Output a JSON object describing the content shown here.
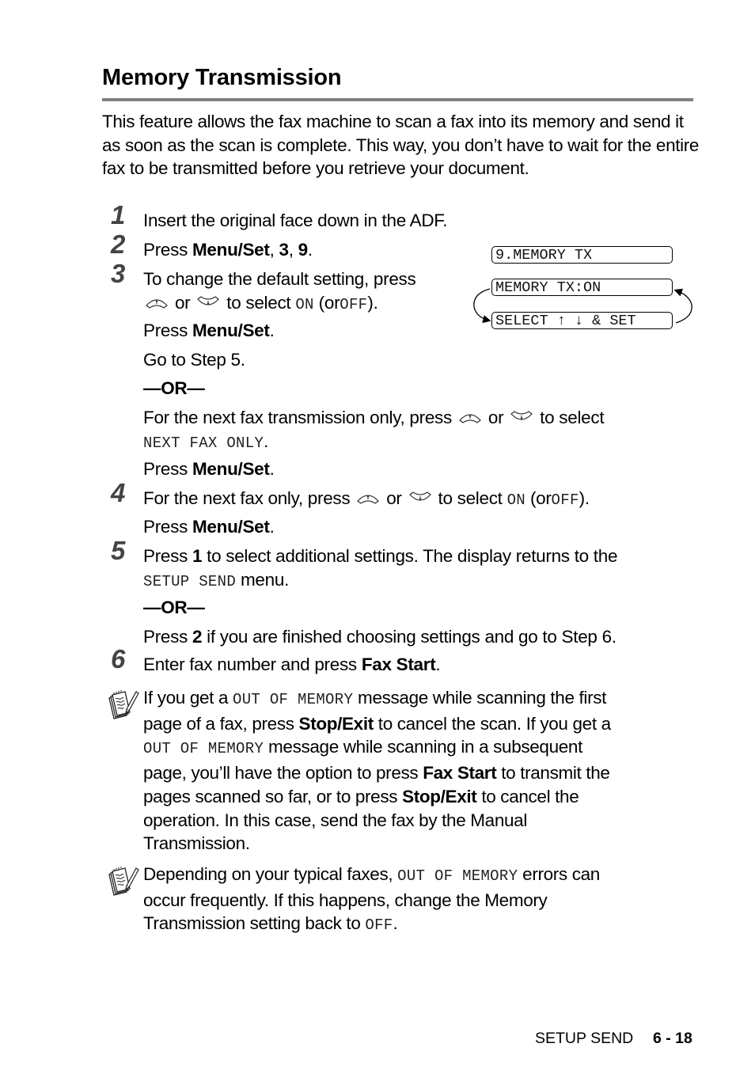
{
  "page_title": "Memory Transmission",
  "intro": "This feature allows the fax machine to scan a fax into its memory and send it as soon as the scan is complete. This way, you don’t have to wait for the entire fax to be transmitted before you retrieve your document.",
  "steps": {
    "s1": {
      "num": "1",
      "text": "Insert the original face down in the ADF."
    },
    "s2": {
      "num": "2",
      "pre": "Press ",
      "b1": "Menu/Set",
      "sep1": ", ",
      "b2": "3",
      "sep2": ", ",
      "b3": "9",
      "post": "."
    },
    "s3": {
      "num": "3",
      "line1": "To change the default setting, press",
      "or": "or",
      "to_select": "to select",
      "on": "ON",
      "paren_or": "(or",
      "off": "OFF",
      "close": ").",
      "press": "Press ",
      "menuset": "Menu/Set",
      "dot": ".",
      "goto": "Go to Step 5.",
      "or_sep": "—OR—",
      "alt_line1_pre": "For the next fax transmission only, press",
      "alt_line1_post": "to select",
      "alt_value": "NEXT FAX ONLY",
      "alt_value_dot": "."
    },
    "s4": {
      "num": "4",
      "pre": "For the next fax only, press",
      "or": "or",
      "to_select": "to select",
      "on": "ON",
      "paren_or": "(or",
      "off": "OFF",
      "close": ")."
    },
    "s5": {
      "num": "5",
      "pre": "Press ",
      "b1": "1",
      "post": " to select additional settings. The display returns to the",
      "menu_value": "SETUP SEND",
      "menu_post": " menu.",
      "or_sep": "—OR—",
      "alt_pre": "Press ",
      "alt_b": "2",
      "alt_post": " if you are finished choosing settings and go to Step 6."
    },
    "s6": {
      "num": "6",
      "pre": "Enter fax number and press ",
      "b1": "Fax Start",
      "post": "."
    }
  },
  "lcd": {
    "line1": "9.MEMORY TX",
    "line2": "MEMORY TX:ON",
    "line3": "SELECT ↑ ↓ & SET"
  },
  "notes": {
    "n1": {
      "a": "If you get a ",
      "m1": "OUT OF MEMORY",
      "b": " message while scanning the first",
      "c": "page of a fax, press ",
      "k1": "Stop/Exit",
      "d": " to cancel the scan. If you get a",
      "m2": "OUT OF MEMORY",
      "e": " message while scanning in a subsequent",
      "f": "page, you’ll have the option to press ",
      "k2": "Fax Start",
      "g": " to transmit the",
      "h": "pages scanned so far, or to press ",
      "k3": "Stop/Exit",
      "i": " to cancel the",
      "j": "operation. In this case, send the fax by the Manual",
      "k": "Transmission."
    },
    "n2": {
      "a": "Depending on your typical faxes, ",
      "m1": "OUT OF MEMORY",
      "b": " errors can",
      "c": "occur frequently. If this happens, change the Memory",
      "d": "Transmission setting back to ",
      "m2": "OFF",
      "e": "."
    }
  },
  "footer": {
    "section": "SETUP SEND",
    "page": "6 - 18"
  },
  "icons": {
    "up": "up-arrow-key-icon",
    "down": "down-arrow-key-icon",
    "note": "note-pad-pencil-icon"
  },
  "colors": {
    "rule": "#808080",
    "step_number": "#444444"
  }
}
